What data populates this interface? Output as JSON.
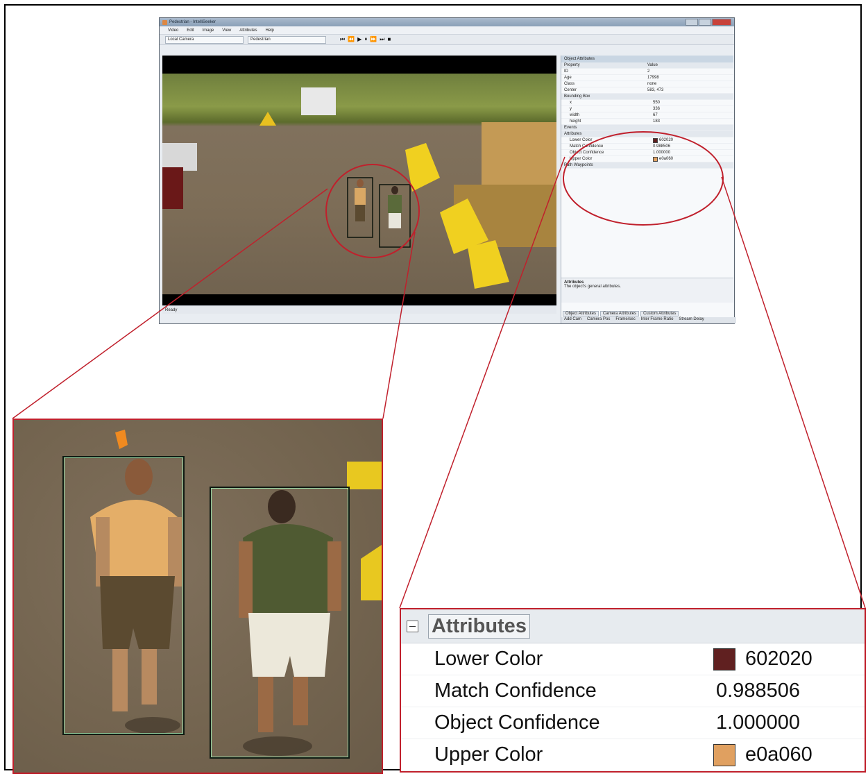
{
  "app": {
    "title": "Pedestrian - IntelliSeeker",
    "menu": [
      "Video",
      "Edit",
      "Image",
      "View",
      "Attributes",
      "Help"
    ],
    "toolbar": {
      "camera": "Local Camera",
      "timeline": "Pedestrian"
    },
    "status": "Ready"
  },
  "properties_panel": {
    "header": "Object Attributes",
    "columns": [
      "Property",
      "Value"
    ],
    "rows": [
      {
        "k": "ID",
        "v": "2"
      },
      {
        "k": "Age",
        "v": "17998"
      },
      {
        "k": "Class",
        "v": "none"
      },
      {
        "k": "Center",
        "v": "583, 473"
      }
    ],
    "bbox_group": "Bounding Box",
    "bbox_rows": [
      {
        "k": "x",
        "v": "550"
      },
      {
        "k": "y",
        "v": "336"
      },
      {
        "k": "width",
        "v": "67"
      },
      {
        "k": "height",
        "v": "183"
      }
    ],
    "events_group": "Events",
    "attributes_group": "Attributes",
    "attr_rows": [
      {
        "k": "Lower Color",
        "v": "602020",
        "color": "#602020"
      },
      {
        "k": "Match Confidence",
        "v": "0.988506"
      },
      {
        "k": "Object Confidence",
        "v": "1.000000"
      },
      {
        "k": "Upper Color",
        "v": "e0a060",
        "color": "#e0a060"
      }
    ],
    "path_group": "Path Waypoints",
    "description_title": "Attributes",
    "description_text": "The object's general attributes.",
    "tabs": [
      "Object Attributes",
      "Camera Attributes",
      "Custom Attributes"
    ],
    "status_items": [
      "Add Cam",
      "Camera Pos",
      "Frame/sec",
      "Inter Frame Ratio",
      "Stream Delay"
    ]
  },
  "zoom_attributes": {
    "title": "Attributes",
    "rows": [
      {
        "label": "Lower Color",
        "value": "602020",
        "color": "#602020"
      },
      {
        "label": "Match Confidence",
        "value": "0.988506"
      },
      {
        "label": "Object Confidence",
        "value": "1.000000"
      },
      {
        "label": "Upper Color",
        "value": "e0a060",
        "color": "#e0a060"
      }
    ]
  },
  "colors": {
    "callout": "#c0202c",
    "bbox": "#9bd7a5"
  }
}
